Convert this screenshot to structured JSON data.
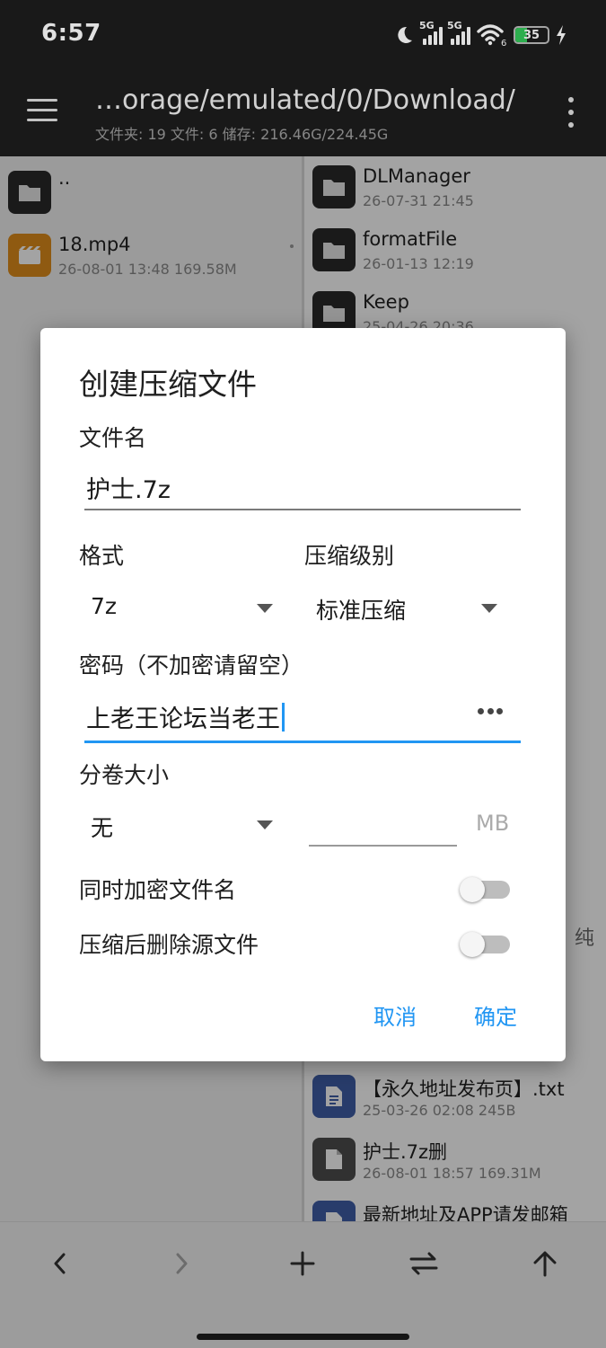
{
  "status_bar": {
    "time": "6:57",
    "sim1": "5G",
    "sim2": "5G",
    "wifi_badge": "6",
    "battery_level": "35",
    "battery_color": "#34c759",
    "icons": [
      "moon-icon",
      "signal-icon",
      "wifi-icon",
      "battery-icon",
      "charging-icon"
    ]
  },
  "app_bar": {
    "path": "…orage/emulated/0/Download/",
    "stats": "文件夹: 19   文件: 6   储存: 216.46G/224.45G"
  },
  "left_pane": {
    "items": [
      {
        "name": "..",
        "meta": "",
        "icon": "folder-icon"
      },
      {
        "name": "18.mp4",
        "meta": "26-08-01 13:48  169.58M",
        "icon": "video-file-icon",
        "icon_color": "#e08e1b"
      }
    ]
  },
  "right_pane": {
    "items": [
      {
        "name": "DLManager",
        "meta": "26-07-31 21:45",
        "icon": "folder-icon"
      },
      {
        "name": "formatFile",
        "meta": "26-01-13 12:19",
        "icon": "folder-icon"
      },
      {
        "name": "Keep",
        "meta": "25-04-26 20:36",
        "icon": "folder-icon"
      },
      {
        "name": "【永久地址发布页】.txt",
        "meta": "25-03-26 02:08  245B",
        "icon": "text-file-icon",
        "icon_color": "#3f5fa8"
      },
      {
        "name": "护士.7z删",
        "meta": "26-08-01 18:57  169.31M",
        "icon": "file-icon",
        "icon_color": "#4d4d4d"
      },
      {
        "name": "最新地址及APP请发邮箱",
        "meta": "",
        "icon": "text-file-icon",
        "icon_color": "#3f5fa8"
      }
    ],
    "partial_text": "纯"
  },
  "dialog": {
    "title": "创建压缩文件",
    "filename_label": "文件名",
    "filename_value": "护士.7z",
    "format_label": "格式",
    "format_value": "7z",
    "level_label": "压缩级别",
    "level_value": "标准压缩",
    "password_label": "密码（不加密请留空）",
    "password_value": "上老王论坛当老王",
    "volume_label": "分卷大小",
    "volume_value": "无",
    "volume_unit": "MB",
    "encrypt_names_label": "同时加密文件名",
    "encrypt_names_on": false,
    "delete_source_label": "压缩后删除源文件",
    "delete_source_on": false,
    "cancel_label": "取消",
    "ok_label": "确定",
    "accent_color": "#2196f3"
  },
  "bottom_bar": {
    "buttons": [
      "back-arrow-icon",
      "forward-arrow-icon",
      "add-icon",
      "swap-icon",
      "up-arrow-icon"
    ]
  }
}
